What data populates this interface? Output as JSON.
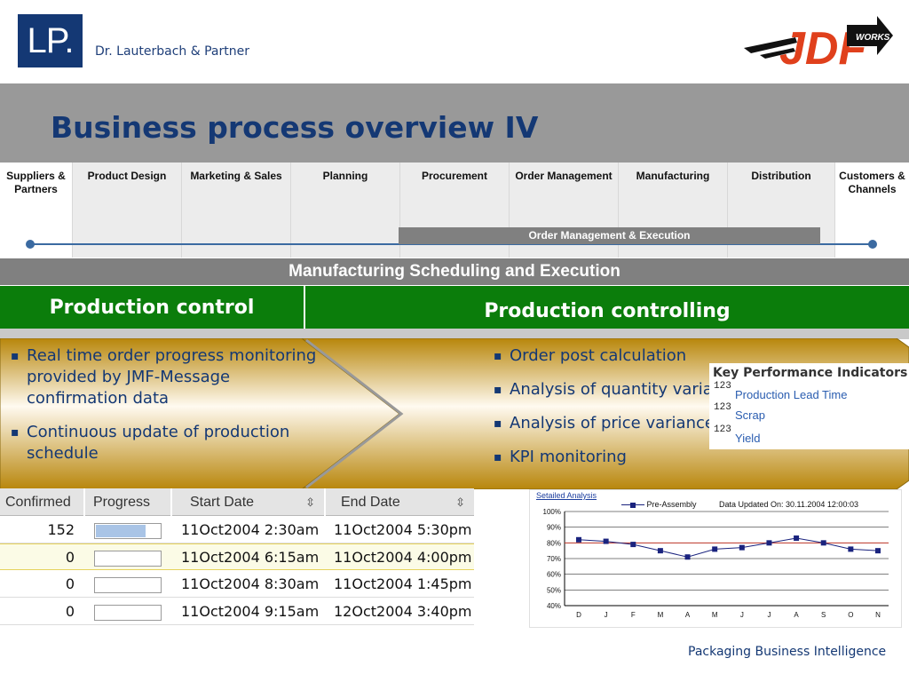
{
  "header": {
    "logo_text": "LP.",
    "company": "Dr. Lauterbach & Partner",
    "jdf_logo_text": "JDF",
    "jdf_badge": "WORKS"
  },
  "title": "Business process overview IV",
  "value_chain": {
    "columns": [
      "Suppliers & Partners",
      "Product Design",
      "Marketing & Sales",
      "Planning",
      "Procurement",
      "Order Management",
      "Manufacturing",
      "Distribution",
      "Customers & Channels"
    ],
    "bar_label": "Order Management & Execution"
  },
  "section_title": "Manufacturing Scheduling and Execution",
  "left_panel": {
    "title": "Production control",
    "bullets": [
      "Real time order progress monitoring provided by JMF-Message confirmation data",
      "Continuous update of production schedule"
    ]
  },
  "right_panel": {
    "title": "Production controlling",
    "bullets": [
      "Order post calculation",
      "Analysis of quantity variances",
      "Analysis of price variances",
      "KPI monitoring"
    ]
  },
  "kpi": {
    "title": "Key Performance Indicators",
    "items": [
      "Production Lead Time",
      "Scrap",
      "Yield"
    ],
    "icon_text": "123"
  },
  "table": {
    "headers": [
      "Confirmed",
      "Progress",
      "Start Date",
      "End Date"
    ],
    "rows": [
      {
        "confirmed": "152",
        "progress": 0.75,
        "start": "11Oct2004 2:30am",
        "end": "11Oct2004 5:30pm"
      },
      {
        "confirmed": "0",
        "progress": 0,
        "start": "11Oct2004 6:15am",
        "end": "11Oct2004 4:00pm"
      },
      {
        "confirmed": "0",
        "progress": 0,
        "start": "11Oct2004 8:30am",
        "end": "11Oct2004 1:45pm"
      },
      {
        "confirmed": "0",
        "progress": 0,
        "start": "11Oct2004 9:15am",
        "end": "12Oct2004 3:40pm"
      }
    ]
  },
  "chart": {
    "tab_label": "Setailed Analysis",
    "updated": "Data Updated On: 30.11.2004 12:00:03"
  },
  "chart_data": {
    "type": "line",
    "categories": [
      "D",
      "J",
      "F",
      "M",
      "A",
      "M",
      "J",
      "J",
      "A",
      "S",
      "O",
      "N"
    ],
    "series": [
      {
        "name": "Pre-Assembly",
        "values": [
          82,
          81,
          79,
          75,
          71,
          76,
          77,
          80,
          83,
          80,
          76,
          75
        ]
      }
    ],
    "reference_line": 80,
    "yticks": [
      "100%",
      "90%",
      "80%",
      "70%",
      "60%",
      "50%",
      "40%"
    ],
    "ylim": [
      40,
      100
    ],
    "colors": {
      "series": "#1a237e",
      "reference": "#c0392b"
    }
  },
  "footer": "Packaging Business Intelligence"
}
